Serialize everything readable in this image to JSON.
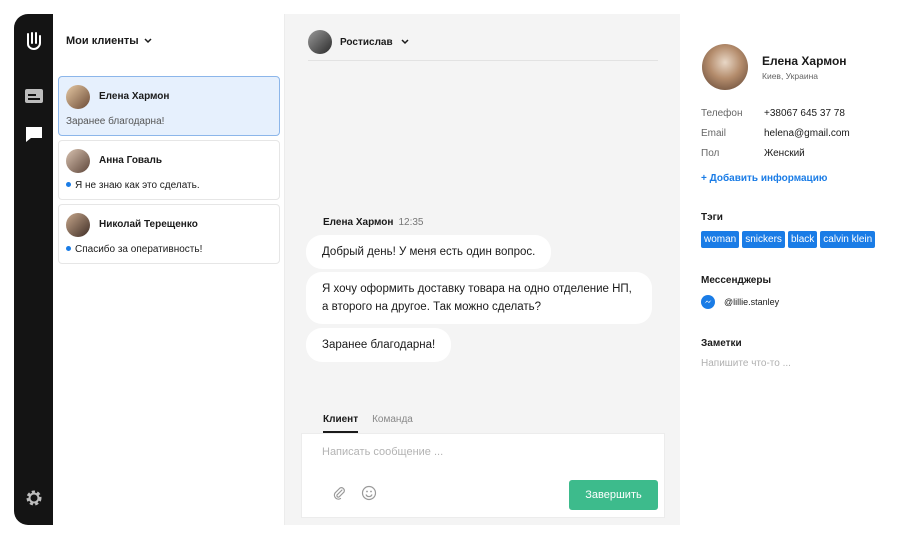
{
  "rail": {
    "icons": [
      "hand-logo-icon",
      "inbox-icon",
      "chat-icon",
      "gear-icon"
    ]
  },
  "clients_panel": {
    "header_label": "Мои клиенты",
    "clients": [
      {
        "name": "Елена Хармон",
        "last_message": "Заранее благодарна!",
        "unread": false,
        "active": true,
        "avatar_color": "#c9a27a"
      },
      {
        "name": "Анна Говаль",
        "last_message": "Я не знаю как это сделать.",
        "unread": true,
        "active": false,
        "avatar_color": "#9a7b6a"
      },
      {
        "name": "Николай Терещенко",
        "last_message": "Спасибо за оперативность!",
        "unread": true,
        "active": false,
        "avatar_color": "#7a5e4e"
      }
    ]
  },
  "chat": {
    "agent_name": "Ростислав",
    "message_author": "Елена Хармон",
    "message_time": "12:35",
    "messages": [
      "Добрый день! У меня есть один вопрос.",
      "Я хочу оформить доставку товара на одно отделение НП, а второго на другое. Так можно сделать?",
      "Заранее благодарна!"
    ],
    "tabs": [
      "Клиент",
      "Команда"
    ],
    "active_tab": "Клиент",
    "composer_placeholder": "Написать сообщение ...",
    "send_label": "Завершить"
  },
  "profile": {
    "name": "Елена Хармон",
    "city": "Киев, Украина",
    "fields": [
      {
        "label": "Телефон",
        "value": "+38067 645 37 78"
      },
      {
        "label": "Email",
        "value": "helena@gmail.com"
      },
      {
        "label": "Пол",
        "value": "Женский"
      }
    ],
    "add_info_label": "+ Добавить информацию",
    "tags_title": "Тэги",
    "tags": [
      "woman",
      "snickers",
      "black",
      "calvin klein"
    ],
    "messengers_title": "Мессенджеры",
    "messenger_handle": "@lillie.stanley",
    "notes_title": "Заметки",
    "notes_placeholder": "Напишите что-то ..."
  },
  "colors": {
    "rail_bg": "#141414",
    "accent_blue": "#1a7ce6",
    "active_card_bg": "#e6f0fd",
    "send_button": "#3dbb8c",
    "chat_bg": "#f4f4f4"
  }
}
